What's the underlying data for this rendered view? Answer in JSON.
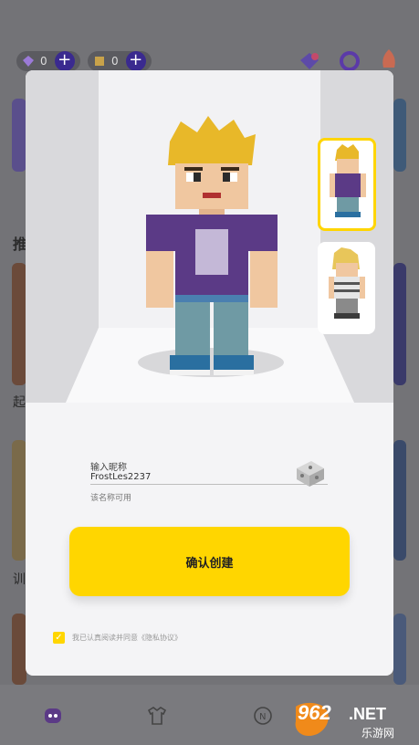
{
  "background": {
    "currency_1": {
      "value": "0",
      "icon": "gem-icon",
      "plus": "+"
    },
    "currency_2": {
      "value": "0",
      "icon": "cube-icon",
      "plus": "+"
    },
    "section_heading_fragment": "推",
    "row_fragment_1": "起",
    "row_fragment_2": "训"
  },
  "dialog": {
    "nickname_label": "输入昵称",
    "nickname_value": "FrostLes2237",
    "nickname_hint": "该名称可用",
    "confirm_label": "确认创建",
    "agreement_text": "我已认真阅读并同意《隐私协议》",
    "agreement_checked": true,
    "check_mark": "✓"
  },
  "watermark": {
    "number": "962",
    "suffix": ".NET",
    "site": "乐游网"
  },
  "colors": {
    "accent": "#ffd600",
    "shirt": "#5b3a86",
    "pants": "#6f9aa4"
  }
}
